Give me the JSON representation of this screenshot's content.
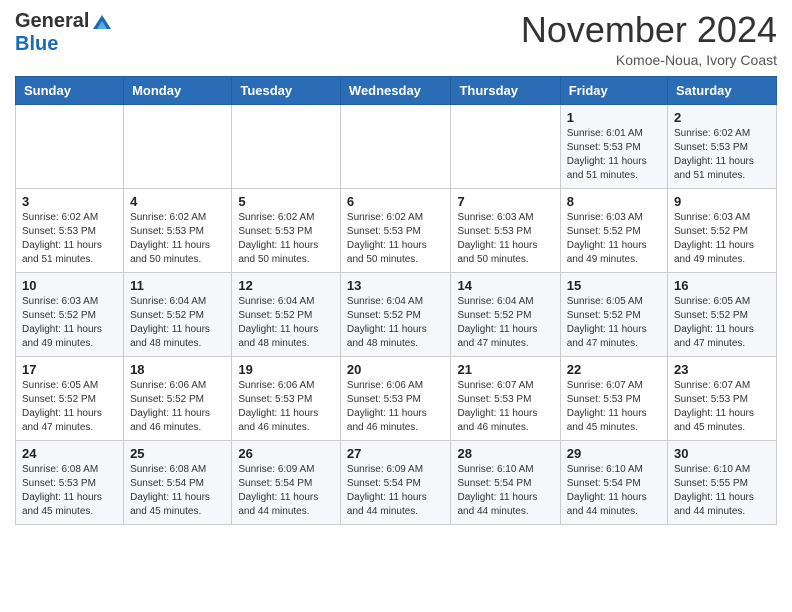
{
  "header": {
    "logo_general": "General",
    "logo_blue": "Blue",
    "month_title": "November 2024",
    "location": "Komoe-Noua, Ivory Coast"
  },
  "weekdays": [
    "Sunday",
    "Monday",
    "Tuesday",
    "Wednesday",
    "Thursday",
    "Friday",
    "Saturday"
  ],
  "weeks": [
    [
      {
        "day": "",
        "info": ""
      },
      {
        "day": "",
        "info": ""
      },
      {
        "day": "",
        "info": ""
      },
      {
        "day": "",
        "info": ""
      },
      {
        "day": "",
        "info": ""
      },
      {
        "day": "1",
        "info": "Sunrise: 6:01 AM\nSunset: 5:53 PM\nDaylight: 11 hours and 51 minutes."
      },
      {
        "day": "2",
        "info": "Sunrise: 6:02 AM\nSunset: 5:53 PM\nDaylight: 11 hours and 51 minutes."
      }
    ],
    [
      {
        "day": "3",
        "info": "Sunrise: 6:02 AM\nSunset: 5:53 PM\nDaylight: 11 hours and 51 minutes."
      },
      {
        "day": "4",
        "info": "Sunrise: 6:02 AM\nSunset: 5:53 PM\nDaylight: 11 hours and 50 minutes."
      },
      {
        "day": "5",
        "info": "Sunrise: 6:02 AM\nSunset: 5:53 PM\nDaylight: 11 hours and 50 minutes."
      },
      {
        "day": "6",
        "info": "Sunrise: 6:02 AM\nSunset: 5:53 PM\nDaylight: 11 hours and 50 minutes."
      },
      {
        "day": "7",
        "info": "Sunrise: 6:03 AM\nSunset: 5:53 PM\nDaylight: 11 hours and 50 minutes."
      },
      {
        "day": "8",
        "info": "Sunrise: 6:03 AM\nSunset: 5:52 PM\nDaylight: 11 hours and 49 minutes."
      },
      {
        "day": "9",
        "info": "Sunrise: 6:03 AM\nSunset: 5:52 PM\nDaylight: 11 hours and 49 minutes."
      }
    ],
    [
      {
        "day": "10",
        "info": "Sunrise: 6:03 AM\nSunset: 5:52 PM\nDaylight: 11 hours and 49 minutes."
      },
      {
        "day": "11",
        "info": "Sunrise: 6:04 AM\nSunset: 5:52 PM\nDaylight: 11 hours and 48 minutes."
      },
      {
        "day": "12",
        "info": "Sunrise: 6:04 AM\nSunset: 5:52 PM\nDaylight: 11 hours and 48 minutes."
      },
      {
        "day": "13",
        "info": "Sunrise: 6:04 AM\nSunset: 5:52 PM\nDaylight: 11 hours and 48 minutes."
      },
      {
        "day": "14",
        "info": "Sunrise: 6:04 AM\nSunset: 5:52 PM\nDaylight: 11 hours and 47 minutes."
      },
      {
        "day": "15",
        "info": "Sunrise: 6:05 AM\nSunset: 5:52 PM\nDaylight: 11 hours and 47 minutes."
      },
      {
        "day": "16",
        "info": "Sunrise: 6:05 AM\nSunset: 5:52 PM\nDaylight: 11 hours and 47 minutes."
      }
    ],
    [
      {
        "day": "17",
        "info": "Sunrise: 6:05 AM\nSunset: 5:52 PM\nDaylight: 11 hours and 47 minutes."
      },
      {
        "day": "18",
        "info": "Sunrise: 6:06 AM\nSunset: 5:52 PM\nDaylight: 11 hours and 46 minutes."
      },
      {
        "day": "19",
        "info": "Sunrise: 6:06 AM\nSunset: 5:53 PM\nDaylight: 11 hours and 46 minutes."
      },
      {
        "day": "20",
        "info": "Sunrise: 6:06 AM\nSunset: 5:53 PM\nDaylight: 11 hours and 46 minutes."
      },
      {
        "day": "21",
        "info": "Sunrise: 6:07 AM\nSunset: 5:53 PM\nDaylight: 11 hours and 46 minutes."
      },
      {
        "day": "22",
        "info": "Sunrise: 6:07 AM\nSunset: 5:53 PM\nDaylight: 11 hours and 45 minutes."
      },
      {
        "day": "23",
        "info": "Sunrise: 6:07 AM\nSunset: 5:53 PM\nDaylight: 11 hours and 45 minutes."
      }
    ],
    [
      {
        "day": "24",
        "info": "Sunrise: 6:08 AM\nSunset: 5:53 PM\nDaylight: 11 hours and 45 minutes."
      },
      {
        "day": "25",
        "info": "Sunrise: 6:08 AM\nSunset: 5:54 PM\nDaylight: 11 hours and 45 minutes."
      },
      {
        "day": "26",
        "info": "Sunrise: 6:09 AM\nSunset: 5:54 PM\nDaylight: 11 hours and 44 minutes."
      },
      {
        "day": "27",
        "info": "Sunrise: 6:09 AM\nSunset: 5:54 PM\nDaylight: 11 hours and 44 minutes."
      },
      {
        "day": "28",
        "info": "Sunrise: 6:10 AM\nSunset: 5:54 PM\nDaylight: 11 hours and 44 minutes."
      },
      {
        "day": "29",
        "info": "Sunrise: 6:10 AM\nSunset: 5:54 PM\nDaylight: 11 hours and 44 minutes."
      },
      {
        "day": "30",
        "info": "Sunrise: 6:10 AM\nSunset: 5:55 PM\nDaylight: 11 hours and 44 minutes."
      }
    ]
  ]
}
